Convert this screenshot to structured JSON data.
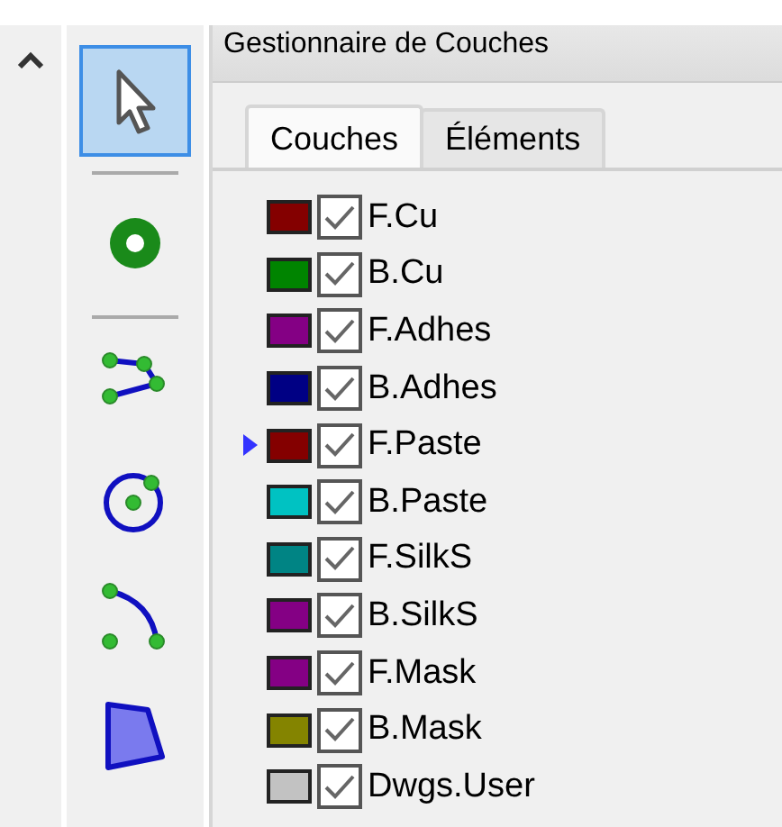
{
  "tools": [
    {
      "kind": "pointer",
      "selected": true
    },
    {
      "kind": "separator"
    },
    {
      "kind": "via",
      "selected": false
    },
    {
      "kind": "separator"
    },
    {
      "kind": "polyline",
      "selected": false
    },
    {
      "kind": "circle",
      "selected": false
    },
    {
      "kind": "arc",
      "selected": false
    },
    {
      "kind": "polygon",
      "selected": false
    }
  ],
  "panel": {
    "title": "Gestionnaire de Couches"
  },
  "tabs": [
    {
      "label": "Couches",
      "selected": true
    },
    {
      "label": "Éléments",
      "selected": false
    }
  ],
  "layers": [
    {
      "name": "F.Cu",
      "color": "#840000",
      "checked": true,
      "selected": false
    },
    {
      "name": "B.Cu",
      "color": "#008400",
      "checked": true,
      "selected": false
    },
    {
      "name": "F.Adhes",
      "color": "#840084",
      "checked": true,
      "selected": false
    },
    {
      "name": "B.Adhes",
      "color": "#000084",
      "checked": true,
      "selected": false
    },
    {
      "name": "F.Paste",
      "color": "#840000",
      "checked": true,
      "selected": true
    },
    {
      "name": "B.Paste",
      "color": "#00c2c2",
      "checked": true,
      "selected": false
    },
    {
      "name": "F.SilkS",
      "color": "#008484",
      "checked": true,
      "selected": false
    },
    {
      "name": "B.SilkS",
      "color": "#840084",
      "checked": true,
      "selected": false
    },
    {
      "name": "F.Mask",
      "color": "#840084",
      "checked": true,
      "selected": false
    },
    {
      "name": "B.Mask",
      "color": "#848400",
      "checked": true,
      "selected": false
    },
    {
      "name": "Dwgs.User",
      "color": "#c2c2c2",
      "checked": true,
      "selected": false
    }
  ]
}
